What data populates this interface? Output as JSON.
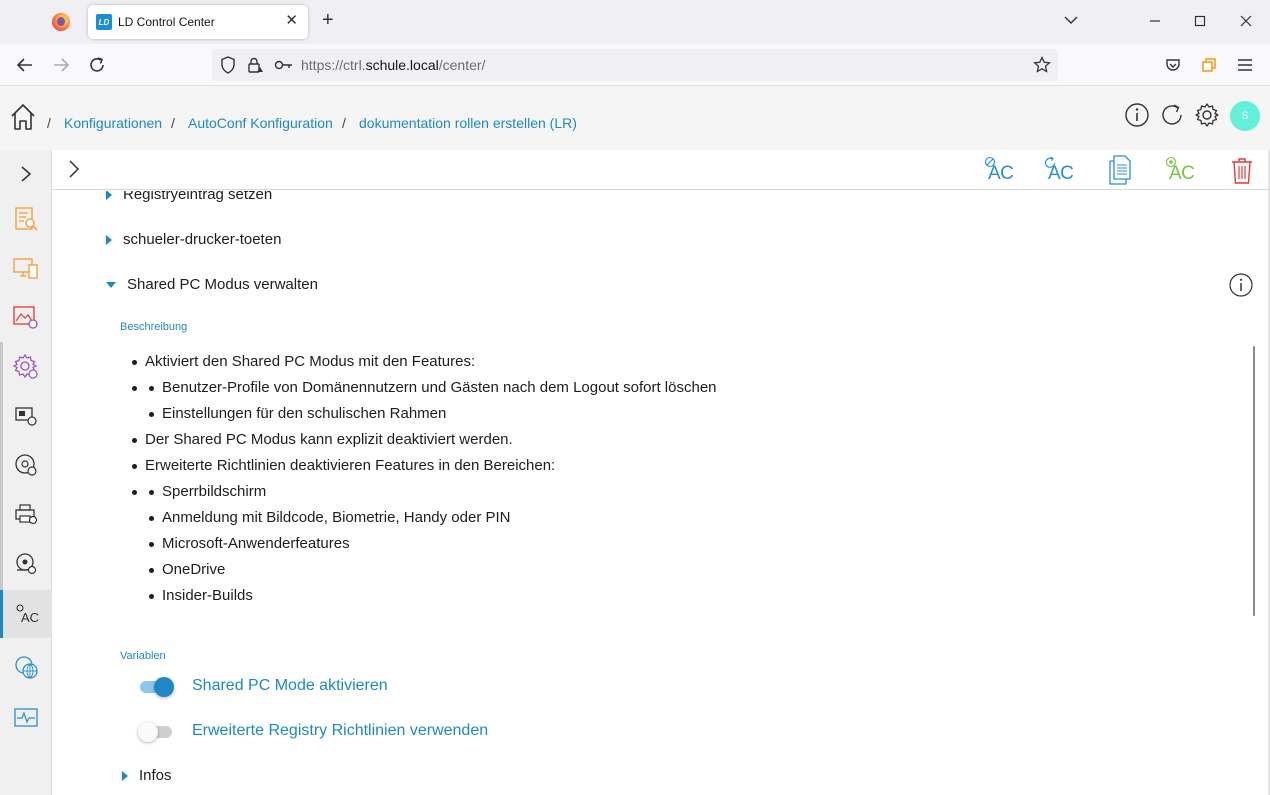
{
  "browser": {
    "tab_title": "LD Control Center",
    "tab_favicon": "LD",
    "new_tab": "+",
    "close_tab": "✕",
    "url_prefix": "https://ctrl.",
    "url_host": "schule.local",
    "url_path": "/center/"
  },
  "app": {
    "avatar": "S",
    "breadcrumb": [
      "Konfigurationen",
      "AutoConf Konfiguration",
      "dokumentation rollen erstellen (LR)"
    ],
    "separator": "/",
    "toolbar_ac": "AC"
  },
  "tree": {
    "item1": "Registryeintrag setzen",
    "item2": "schueler-drucker-toeten",
    "item3": "Shared PC Modus verwalten",
    "infos": "Infos"
  },
  "details": {
    "description_label": "Beschreibung",
    "bullets": [
      "Aktiviert den Shared PC Modus mit den Features:",
      "Benutzer-Profile von Domänennutzern und Gästen nach dem Logout sofort löschen",
      "Einstellungen für den schulischen Rahmen",
      "Der Shared PC Modus kann explizit deaktiviert werden.",
      "Erweiterte Richtlinien deaktivieren Features in den Bereichen:",
      "Sperrbildschirm",
      "Anmeldung mit Bildcode, Biometrie, Handy oder PIN",
      "Microsoft-Anwenderfeatures",
      "OneDrive",
      "Insider-Builds"
    ],
    "variables_label": "Variablen",
    "variables": [
      {
        "label": "Shared PC Mode aktivieren",
        "enabled": true
      },
      {
        "label": "Erweiterte Registry Richtlinien verwenden",
        "enabled": false
      }
    ]
  },
  "colors": {
    "accent": "#1e88c7",
    "avatar": "#64f0d8",
    "delete": "#e53935",
    "green_ac": "#7cc242",
    "sidebar_orange": "#f39c33",
    "sidebar_purple": "#9b4fc4"
  }
}
